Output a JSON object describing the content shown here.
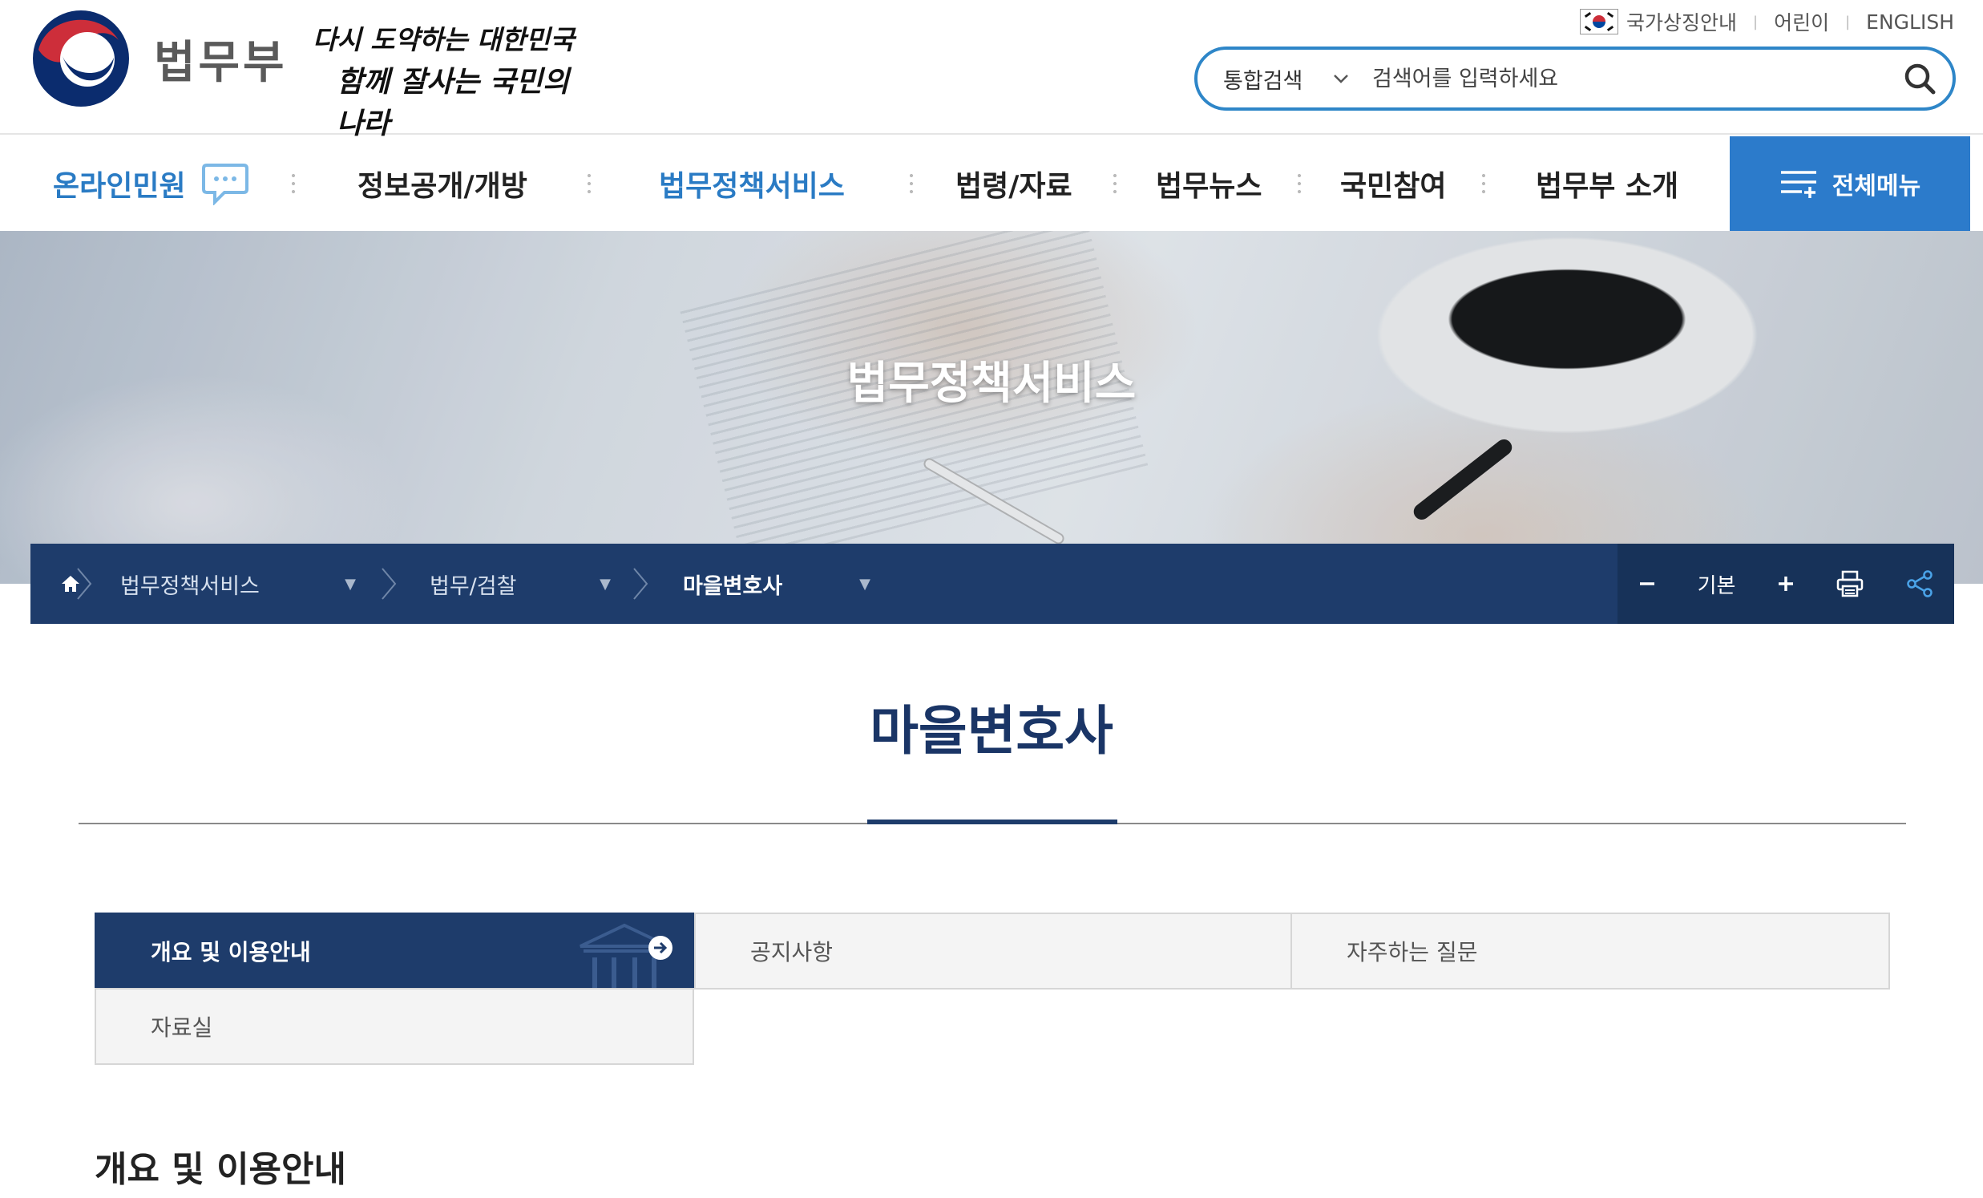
{
  "header": {
    "org_name": "법무부",
    "slogan_line1": "다시 도약하는 대한민국",
    "slogan_line2": "함께 잘사는 국민의 나라",
    "util_links": [
      "국가상징안내",
      "어린이",
      "ENGLISH"
    ],
    "search": {
      "scope_label": "통합검색",
      "placeholder": "검색어를 입력하세요"
    }
  },
  "gnb": {
    "items": [
      "온라인민원",
      "정보공개/개방",
      "법무정책서비스",
      "법령/자료",
      "법무뉴스",
      "국민참여",
      "법무부 소개"
    ],
    "all_menu_label": "전체메뉴"
  },
  "visual": {
    "title": "법무정책서비스"
  },
  "breadcrumb": {
    "items": [
      "법무정책서비스",
      "법무/검찰",
      "마을변호사"
    ],
    "zoom_label": "기본"
  },
  "page": {
    "title": "마을변호사",
    "section_title": "개요 및 이용안내"
  },
  "tabs": [
    "개요 및 이용안내",
    "공지사항",
    "자주하는 질문",
    "자료실"
  ],
  "colors": {
    "primary_navy": "#1e3c6b",
    "accent_blue": "#2c7bcb",
    "active_menu_blue": "#2a7bc4",
    "emblem_red": "#cd2e3a",
    "emblem_blue": "#0047a0"
  }
}
